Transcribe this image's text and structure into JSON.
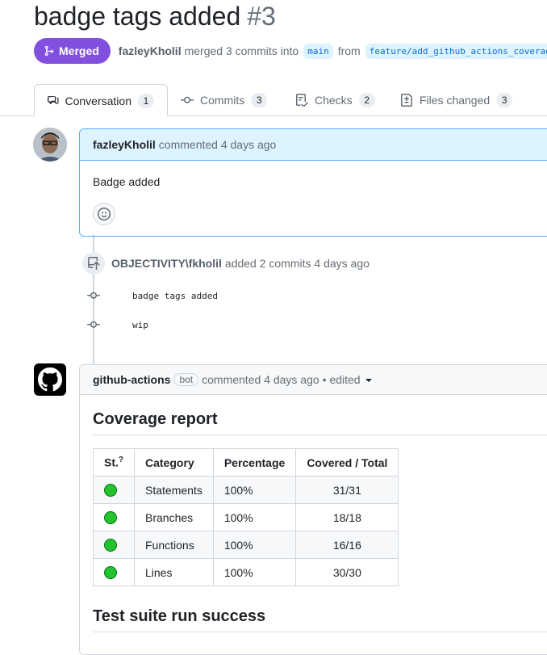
{
  "pr": {
    "title": "badge tags added",
    "number": "#3",
    "status": "Merged",
    "author": "fazleyKholil",
    "merge_text": "merged 3 commits into",
    "base_branch": "main",
    "from_text": "from",
    "head_branch": "feature/add_github_actions_coverage"
  },
  "tabs": [
    {
      "label": "Conversation",
      "count": "1",
      "icon": "comment-discussion-icon"
    },
    {
      "label": "Commits",
      "count": "3",
      "icon": "git-commit-icon"
    },
    {
      "label": "Checks",
      "count": "2",
      "icon": "checklist-icon"
    },
    {
      "label": "Files changed",
      "count": "3",
      "icon": "file-diff-icon"
    }
  ],
  "first_comment": {
    "author": "fazleyKholil",
    "action": "commented 4 days ago",
    "body": "Badge added"
  },
  "commit_event": {
    "actor": "OBJECTIVITY\\fkholil",
    "text": "added 2 commits 4 days ago",
    "commits": [
      "badge tags added",
      "wip"
    ]
  },
  "bot_comment": {
    "author": "github-actions",
    "label": "bot",
    "action": "commented 4 days ago",
    "edited": "• edited",
    "coverage_heading": "Coverage report",
    "table": {
      "headers": [
        "St.",
        "Category",
        "Percentage",
        "Covered / Total"
      ],
      "status_hint": "?",
      "rows": [
        {
          "category": "Statements",
          "percentage": "100%",
          "covered": "31/31"
        },
        {
          "category": "Branches",
          "percentage": "100%",
          "covered": "18/18"
        },
        {
          "category": "Functions",
          "percentage": "100%",
          "covered": "16/16"
        },
        {
          "category": "Lines",
          "percentage": "100%",
          "covered": "30/30"
        }
      ]
    },
    "suite_heading": "Test suite run success"
  },
  "colors": {
    "merged": "#8250df",
    "status_green": "#22c42e",
    "accent": "#0969da"
  }
}
